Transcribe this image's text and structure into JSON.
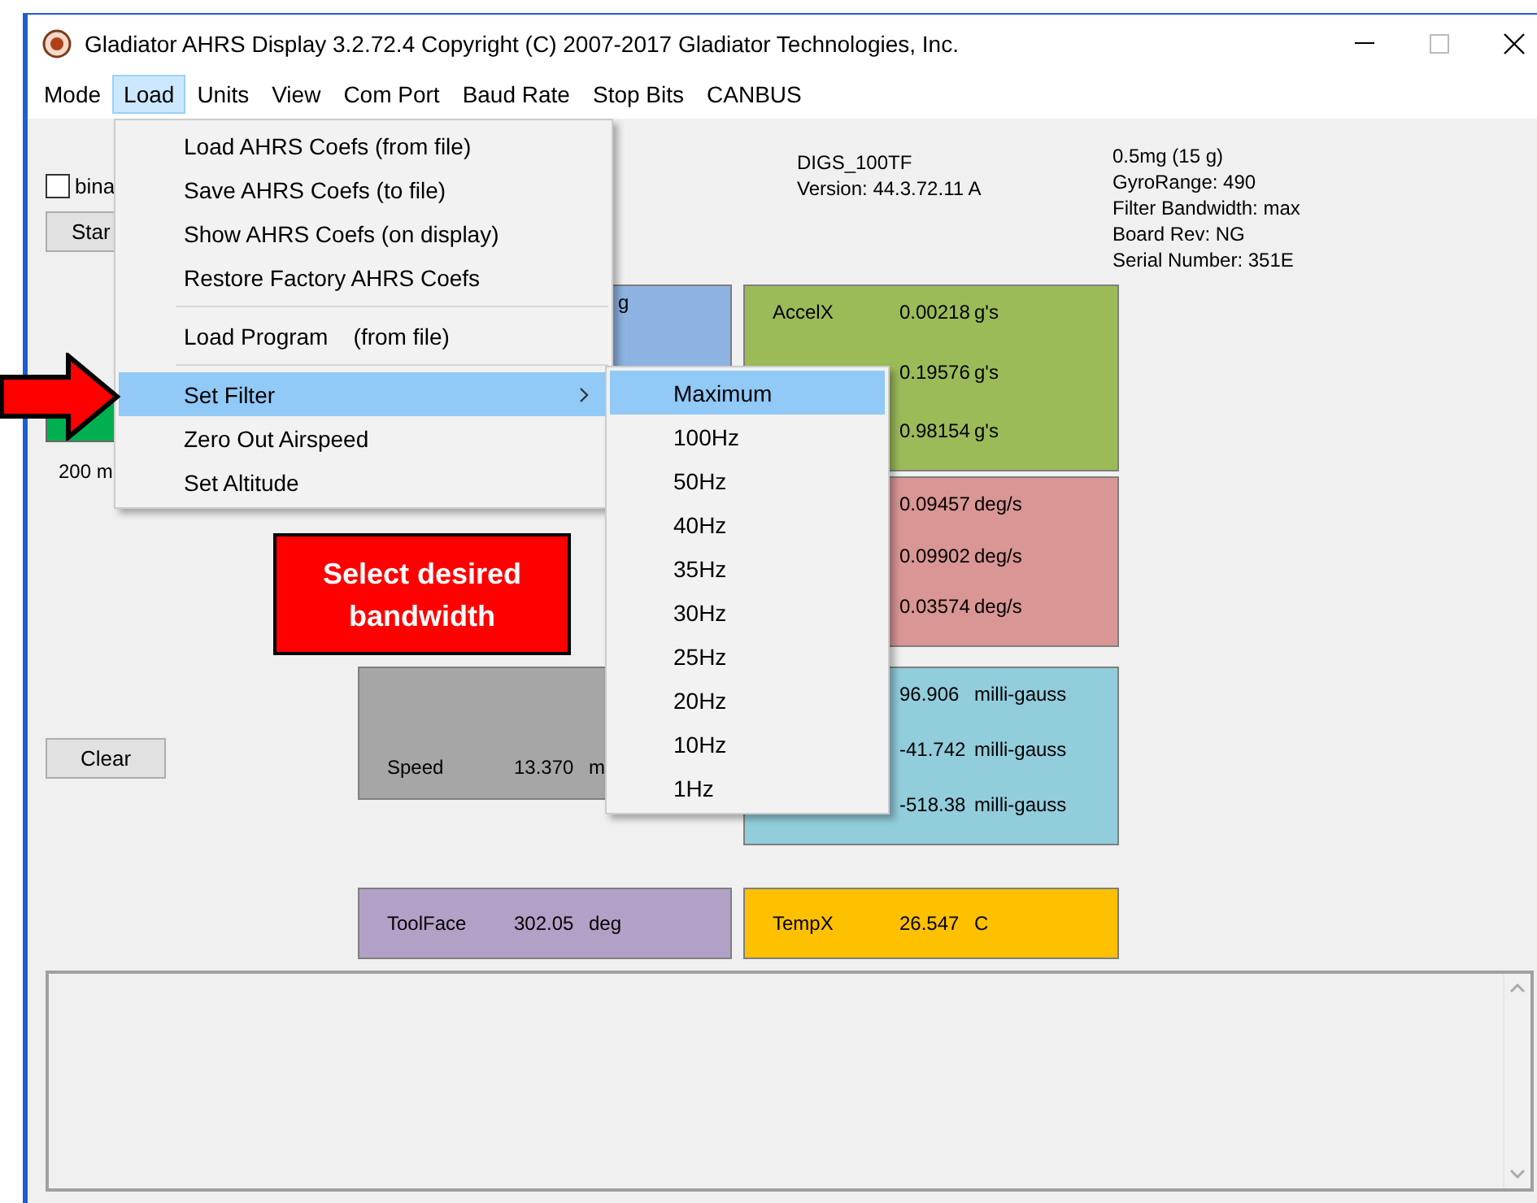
{
  "window": {
    "title": "Gladiator AHRS Display 3.2.72.4  Copyright (C) 2007-2017 Gladiator Technologies, Inc."
  },
  "menu_bar": [
    {
      "label": "Mode",
      "selected": false
    },
    {
      "label": "Load",
      "selected": true
    },
    {
      "label": "Units",
      "selected": false
    },
    {
      "label": "View",
      "selected": false
    },
    {
      "label": "Com Port",
      "selected": false
    },
    {
      "label": "Baud Rate",
      "selected": false
    },
    {
      "label": "Stop Bits",
      "selected": false
    },
    {
      "label": "CANBUS",
      "selected": false
    }
  ],
  "controls": {
    "checkbox": {
      "label": "bina",
      "checked": false
    },
    "start_button": "Star",
    "rate_label": "200 m",
    "clear_button": "Clear"
  },
  "device_info": [
    "DIGS_100TF",
    "Version: 44.3.72.11 A"
  ],
  "sensor_info": [
    "0.5mg (15 g)",
    "GyroRange: 490",
    "Filter Bandwidth: max",
    "Board Rev: NG",
    "Serial Number: 351E"
  ],
  "panels": [
    {
      "color": "#8db3e2",
      "rows": [
        {
          "unit": "g"
        }
      ]
    },
    {
      "color": "#9bbb59",
      "rows": [
        {
          "label": "AccelX",
          "value": "0.00218",
          "unit": "g's"
        },
        {
          "value": "0.19576",
          "unit": "g's"
        },
        {
          "value": "0.98154",
          "unit": "g's"
        }
      ]
    },
    {
      "color": "#d99694",
      "rows": [
        {
          "value": "0.09457",
          "unit": "deg/s"
        },
        {
          "value": "0.09902",
          "unit": "deg/s"
        },
        {
          "value": "0.03574",
          "unit": "deg/s"
        }
      ]
    },
    {
      "color": "#a6a6a6",
      "rows": [
        {
          "label": "Speed",
          "value": "13.370",
          "unit": "m"
        }
      ]
    },
    {
      "color": "#92cddc",
      "rows": [
        {
          "value": "96.906",
          "unit": "milli-gauss"
        },
        {
          "value": "-41.742",
          "unit": "milli-gauss"
        },
        {
          "value": "-518.38",
          "unit": "milli-gauss"
        }
      ]
    },
    {
      "color": "#b2a1c7",
      "rows": [
        {
          "label": "ToolFace",
          "value": "302.05",
          "unit": "deg"
        }
      ]
    },
    {
      "color": "#ffc000",
      "rows": [
        {
          "label": "TempX",
          "value": "26.547",
          "unit": "C"
        }
      ]
    }
  ],
  "load_menu": {
    "items": [
      {
        "kind": "item",
        "label": "Load AHRS Coefs (from file)",
        "selected": false
      },
      {
        "kind": "item",
        "label": "Save AHRS Coefs (to file)",
        "selected": false
      },
      {
        "kind": "item",
        "label": "Show AHRS Coefs (on display)",
        "selected": false
      },
      {
        "kind": "item",
        "label": "Restore Factory AHRS Coefs",
        "selected": false
      },
      {
        "kind": "separator"
      },
      {
        "kind": "item",
        "label": "Load Program    (from file)",
        "selected": false
      },
      {
        "kind": "separator"
      },
      {
        "kind": "submenu",
        "label": "Set Filter",
        "selected": true
      },
      {
        "kind": "item",
        "label": "Zero Out Airspeed",
        "selected": false
      },
      {
        "kind": "item",
        "label": "Set Altitude",
        "selected": false
      }
    ]
  },
  "filter_submenu": {
    "items": [
      {
        "label": "Maximum",
        "selected": true
      },
      {
        "label": "100Hz",
        "selected": false
      },
      {
        "label": "50Hz",
        "selected": false
      },
      {
        "label": "40Hz",
        "selected": false
      },
      {
        "label": "35Hz",
        "selected": false
      },
      {
        "label": "30Hz",
        "selected": false
      },
      {
        "label": "25Hz",
        "selected": false
      },
      {
        "label": "20Hz",
        "selected": false
      },
      {
        "label": "10Hz",
        "selected": false
      },
      {
        "label": "1Hz",
        "selected": false
      }
    ]
  },
  "callout": {
    "text": "Select desired bandwidth"
  }
}
